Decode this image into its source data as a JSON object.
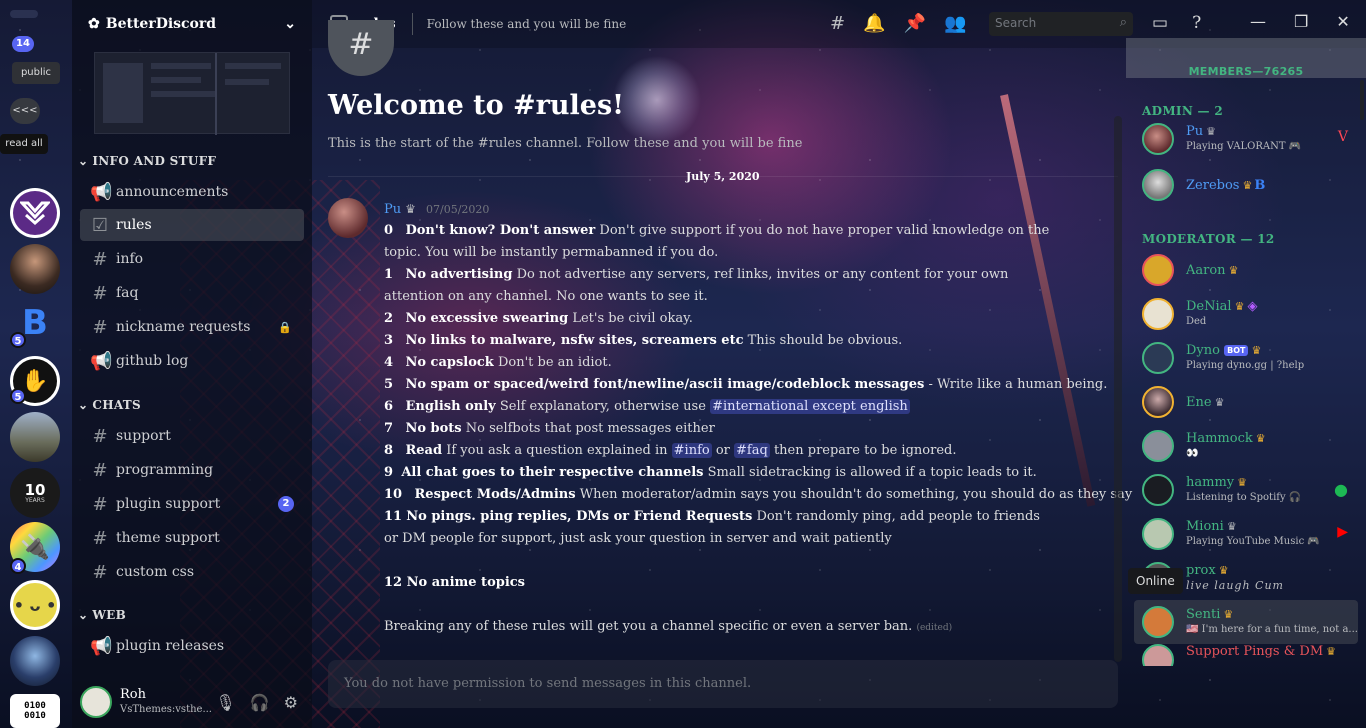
{
  "guild_bar": {
    "mentions_badge": "14",
    "public_tag": "public",
    "collapse_label": "<<<",
    "read_all_label": "read all",
    "guild_badges": [
      "5",
      "5",
      "4"
    ],
    "ten_years_label": "10",
    "ten_years_sub": "YEARS"
  },
  "server": {
    "name": "BetterDiscord",
    "categories": [
      {
        "name": "INFO AND STUFF",
        "channels": [
          {
            "name": "announcements",
            "type": "announcement"
          },
          {
            "name": "rules",
            "type": "rules",
            "active": true
          },
          {
            "name": "info",
            "type": "text"
          },
          {
            "name": "faq",
            "type": "text"
          },
          {
            "name": "nickname requests",
            "type": "text",
            "locked": true
          },
          {
            "name": "github log",
            "type": "announcement"
          }
        ]
      },
      {
        "name": "CHATS",
        "channels": [
          {
            "name": "support",
            "type": "text"
          },
          {
            "name": "programming",
            "type": "text"
          },
          {
            "name": "plugin support",
            "type": "text",
            "badge": "2"
          },
          {
            "name": "theme support",
            "type": "text"
          },
          {
            "name": "custom css",
            "type": "text"
          }
        ]
      },
      {
        "name": "WEB",
        "channels": [
          {
            "name": "plugin releases",
            "type": "announcement"
          }
        ]
      }
    ]
  },
  "user_panel": {
    "name": "Roh",
    "status": "VsThemes:vsthe..."
  },
  "topbar": {
    "channel": "rules",
    "topic": "Follow these and you will be fine",
    "search_placeholder": "Search"
  },
  "welcome": {
    "title": "Welcome to #rules!",
    "subtitle": "This is the start of the #rules channel. Follow these and you will be fine",
    "date": "July 5, 2020"
  },
  "message": {
    "author": "Pu",
    "timestamp": "07/05/2020",
    "rules": [
      {
        "num": "0",
        "title": "Don't know? Don't answer",
        "text": "Don't give support if you do not have proper valid knowledge on the topic. You will be instantly permabanned if you do."
      },
      {
        "num": "1",
        "title": "No advertising",
        "text": "Do not advertise any servers, ref links, invites or any content for your own attention on any channel. No one wants to see it."
      },
      {
        "num": "2",
        "title": "No excessive swearing",
        "text": "Let's be civil okay."
      },
      {
        "num": "3",
        "title": "No links to malware, nsfw sites, screamers etc",
        "text": "This should be obvious."
      },
      {
        "num": "4",
        "title": "No capslock",
        "text": "Don't be an idiot."
      },
      {
        "num": "5",
        "title": "No spam or spaced/weird font/newline/ascii image/codeblock messages",
        "text": "- Write like a human being."
      },
      {
        "num": "6",
        "title": "English only",
        "text": "Self explanatory, otherwise use",
        "mention": "#international except english"
      },
      {
        "num": "7",
        "title": "No bots",
        "text": "No selfbots that post messages either"
      },
      {
        "num": "8",
        "title": "Read",
        "text": "If you ask a question explained in",
        "mention": "#info",
        "mid": "or",
        "mention2": "#faq",
        "tail": "then prepare to be ignored."
      },
      {
        "num": "9",
        "title": "All chat goes to their respective channels",
        "text": "Small sidetracking is allowed if a topic leads to it."
      },
      {
        "num": "10",
        "title": "Respect Mods/Admins",
        "text": "When moderator/admin says you shouldn't do something, you should do as they say"
      },
      {
        "num": "11",
        "title": "No pings. ping replies, DMs or Friend Requests",
        "text": "Don't randomly ping, add people to friends or DM people for support, just ask your question in server and wait patiently"
      }
    ],
    "rule12": "12 No anime topics",
    "footer": "Breaking any of these rules will get you a channel specific or even a server ban.",
    "edited": "(edited)"
  },
  "composer": {
    "placeholder": "You do not have permission to send messages in this channel."
  },
  "members": {
    "header": "MEMBERS—76265",
    "roles": [
      {
        "name": "ADMIN — 2",
        "color": "#43b581"
      },
      {
        "name": "MODERATOR — 12",
        "color": "#43b581"
      }
    ],
    "list": [
      {
        "name": "Pu",
        "activity": "Playing VALORANT 🎮",
        "color": "#4f9cf5",
        "crown": "gray"
      },
      {
        "name": "Zerebos",
        "activity": "",
        "color": "#4f9cf5",
        "crown": "gold"
      },
      {
        "name": "Aaron",
        "activity": "",
        "color": "#43b581",
        "crown": "gold"
      },
      {
        "name": "DeNial",
        "activity": "Ded",
        "color": "#43b581",
        "crown": "gold"
      },
      {
        "name": "Dyno",
        "activity": "Playing dyno.gg | ?help",
        "color": "#43b581",
        "crown": "gold",
        "bot": "BOT"
      },
      {
        "name": "Ene",
        "activity": "",
        "color": "#43b581",
        "crown": "gray"
      },
      {
        "name": "Hammock",
        "activity": "👀",
        "color": "#43b581",
        "crown": "gold"
      },
      {
        "name": "hammy",
        "activity": "Listening to Spotify 🎧",
        "color": "#43b581",
        "crown": "gold"
      },
      {
        "name": "Mioni",
        "activity": "Playing YouTube Music 🎮",
        "color": "#43b581",
        "crown": "gray"
      },
      {
        "name": "prox",
        "activity": "live laugh Cum",
        "color": "#43b581",
        "crown": "gold"
      },
      {
        "name": "Senti",
        "activity": "🇺🇸 I'm here for a fun time, not a...",
        "color": "#43b581",
        "crown": "gold"
      },
      {
        "name": "Support Pings & DM",
        "activity": "",
        "color": "#e8545a",
        "crown": "gold"
      }
    ],
    "tooltip": "Online"
  }
}
